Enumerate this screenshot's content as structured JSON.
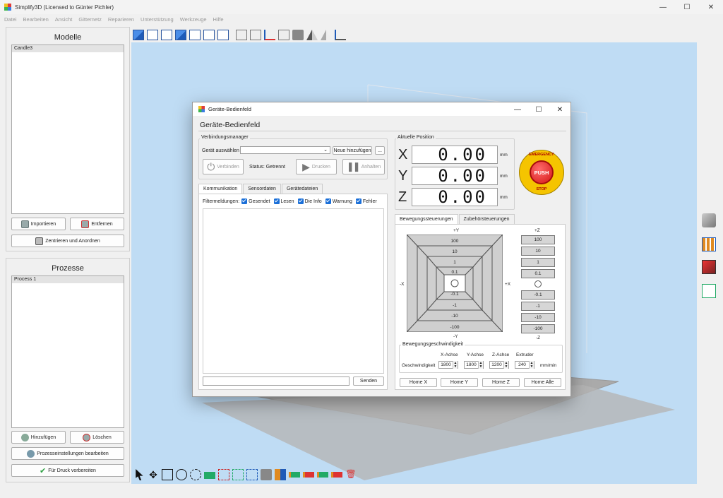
{
  "window": {
    "title": "Simplify3D (Licensed to Günter Pichler)",
    "min": "—",
    "max": "☐",
    "close": "✕"
  },
  "menu": [
    "Datei",
    "Bearbeiten",
    "Ansicht",
    "Gitternetz",
    "Reparieren",
    "Unterstützung",
    "Werkzeuge",
    "Hilfe"
  ],
  "models": {
    "title": "Modelle",
    "items": [
      "Candle3"
    ],
    "import": "Importieren",
    "remove": "Entfernen",
    "center": "Zentrieren und Anordnen"
  },
  "processes": {
    "title": "Prozesse",
    "items": [
      "Process 1"
    ],
    "add": "Hinzufügen",
    "delete": "Löschen",
    "edit": "Prozesseinstellungen bearbeiten",
    "prepare": "Für Druck vorbereiten"
  },
  "dialog": {
    "title": "Geräte-Bedienfeld",
    "heading": "Geräte-Bedienfeld",
    "conn": {
      "label": "Verbindungsmanager",
      "select_label": "Gerät auswählen",
      "select_value": "",
      "add": "Neue hinzufügen",
      "more": "...",
      "connect": "Verbinden",
      "status": "Status: Getrennt",
      "print": "Drucken",
      "pause": "Anhalten"
    },
    "tabs": [
      "Kommunikation",
      "Sensordaten",
      "Gerätedateien"
    ],
    "filter_label": "Filtermeldungen:",
    "filters": [
      "Gesendet",
      "Lesen",
      "Die Info",
      "Warnung",
      "Fehler"
    ],
    "send": "Senden",
    "command_value": "",
    "position": {
      "label": "Aktuelle Position",
      "unit": "mm",
      "axes": [
        {
          "axis": "X",
          "value": "0.00"
        },
        {
          "axis": "Y",
          "value": "0.00"
        },
        {
          "axis": "Z",
          "value": "0.00"
        }
      ]
    },
    "estop": {
      "top": "EMERGENCY",
      "center": "PUSH",
      "bottom": "STOP"
    },
    "move_tabs": [
      "Bewegungssteuerungen",
      "Zubehörsteuerungen"
    ],
    "jog": {
      "plus_y": "+Y",
      "minus_y": "-Y",
      "minus_x": "-X",
      "plus_x": "+X",
      "plus_z": "+Z",
      "minus_z": "-Z",
      "y_steps": [
        "100",
        "10",
        "1",
        "0.1",
        "-0.1",
        "-1",
        "-10",
        "-100"
      ],
      "z_steps": [
        "100",
        "10",
        "1",
        "0.1",
        "-0.1",
        "-1",
        "-10",
        "-100"
      ]
    },
    "speed": {
      "label": "Bewegungsgeschwindigkeit",
      "row_label": "Geschwindigkeit",
      "cols": [
        "X-Achse",
        "Y-Achse",
        "Z-Achse",
        "Extruder"
      ],
      "values": [
        "1800",
        "1800",
        "1200",
        "240"
      ],
      "unit": "mm/min"
    },
    "home": [
      "Home X",
      "Home Y",
      "Home Z",
      "Home Alle"
    ]
  },
  "colors": {
    "accent": "#1a6fd8",
    "viewport": "#bfdcf4",
    "estop": "#e02020",
    "estop_ring": "#f5c400"
  }
}
